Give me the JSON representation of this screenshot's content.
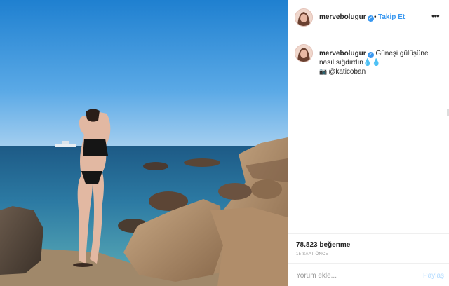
{
  "post": {
    "username": "mervebolugur",
    "verified_icon": "verified-check-icon",
    "bullet": "•",
    "follow_label": "Takip Et",
    "more_label": "•••"
  },
  "caption": {
    "username": "mervebolugur",
    "text": "Güneşi gülüşüne nasıl sığdırdın",
    "emoji": "💧💧",
    "camera_icon": "📷",
    "mention": "@katicoban"
  },
  "stats": {
    "likes": "78.823 beğenme",
    "time": "15 SAAT ÖNCE"
  },
  "comment": {
    "placeholder": "Yorum ekle...",
    "share_label": "Paylaş"
  },
  "colors": {
    "link": "#3897f0",
    "share_disabled": "#b3dbff",
    "sky": "#2f8fd6",
    "sea": "#2a6f9a"
  }
}
